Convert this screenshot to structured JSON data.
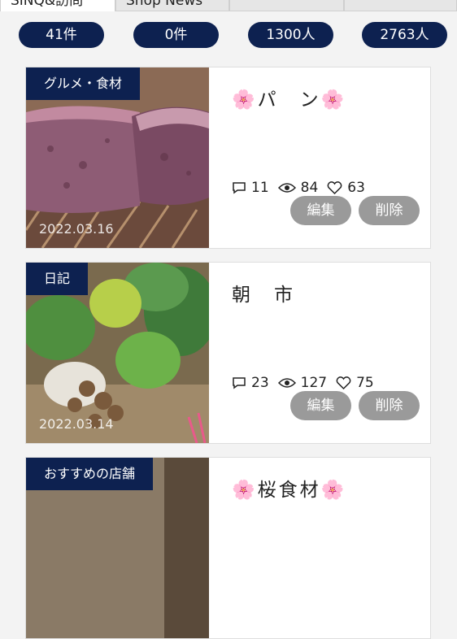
{
  "tabs": [
    "SINQ&訪問",
    "Shop News",
    "",
    ""
  ],
  "stats": [
    "41件",
    "0件",
    "1300人",
    "2763人"
  ],
  "posts": [
    {
      "category": "グルメ・食材",
      "date": "2022.03.16",
      "title": "🌸パ　ン🌸",
      "comments": "11",
      "views": "84",
      "likes": "63",
      "edit": "編集",
      "delete": "削除"
    },
    {
      "category": "日記",
      "date": "2022.03.14",
      "title": "朝　市",
      "comments": "23",
      "views": "127",
      "likes": "75",
      "edit": "編集",
      "delete": "削除"
    },
    {
      "category": "おすすめの店舗",
      "title": "🌸桜食材🌸"
    }
  ],
  "colors": {
    "navy": "#0d2150",
    "button_gray": "#9a9a9a"
  },
  "icons": {
    "comment": "comment-icon",
    "views": "eye-icon",
    "likes": "heart-icon"
  }
}
